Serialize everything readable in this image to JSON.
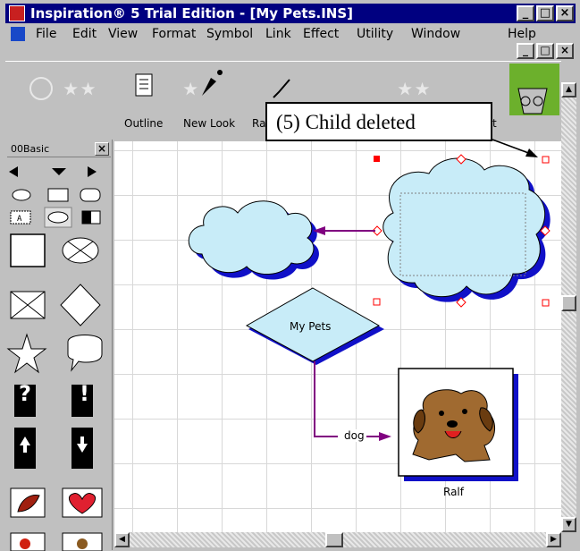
{
  "window": {
    "title": "Inspiration® 5 Trial Edition - [My Pets.INS]",
    "min_glyph": "_",
    "max_glyph": "□",
    "close_glyph": "×"
  },
  "menu": {
    "items": [
      {
        "label": "File"
      },
      {
        "label": "Edit"
      },
      {
        "label": "View"
      },
      {
        "label": "Format"
      },
      {
        "label": "Symbol"
      },
      {
        "label": "Link"
      },
      {
        "label": "Effect"
      },
      {
        "label": "Utility"
      },
      {
        "label": "Window"
      },
      {
        "label": "Help"
      }
    ]
  },
  "toolbar": {
    "outline": "Outline",
    "new_look": "New Look",
    "ra": "Ra",
    "t": "t"
  },
  "callout": {
    "text": "(5) Child deleted"
  },
  "palette": {
    "title": "00Basic",
    "close": "×",
    "question": "?",
    "exclaim": "!"
  },
  "diagram": {
    "main_node": "My Pets",
    "link_label": "dog",
    "picture_caption": "Ralf"
  },
  "colors": {
    "title_bar": "#000080",
    "cloud_fill": "#c8ecf8",
    "shadow_blue": "#1010c8",
    "link_purple": "#800080",
    "selection_red": "#ff0000"
  }
}
